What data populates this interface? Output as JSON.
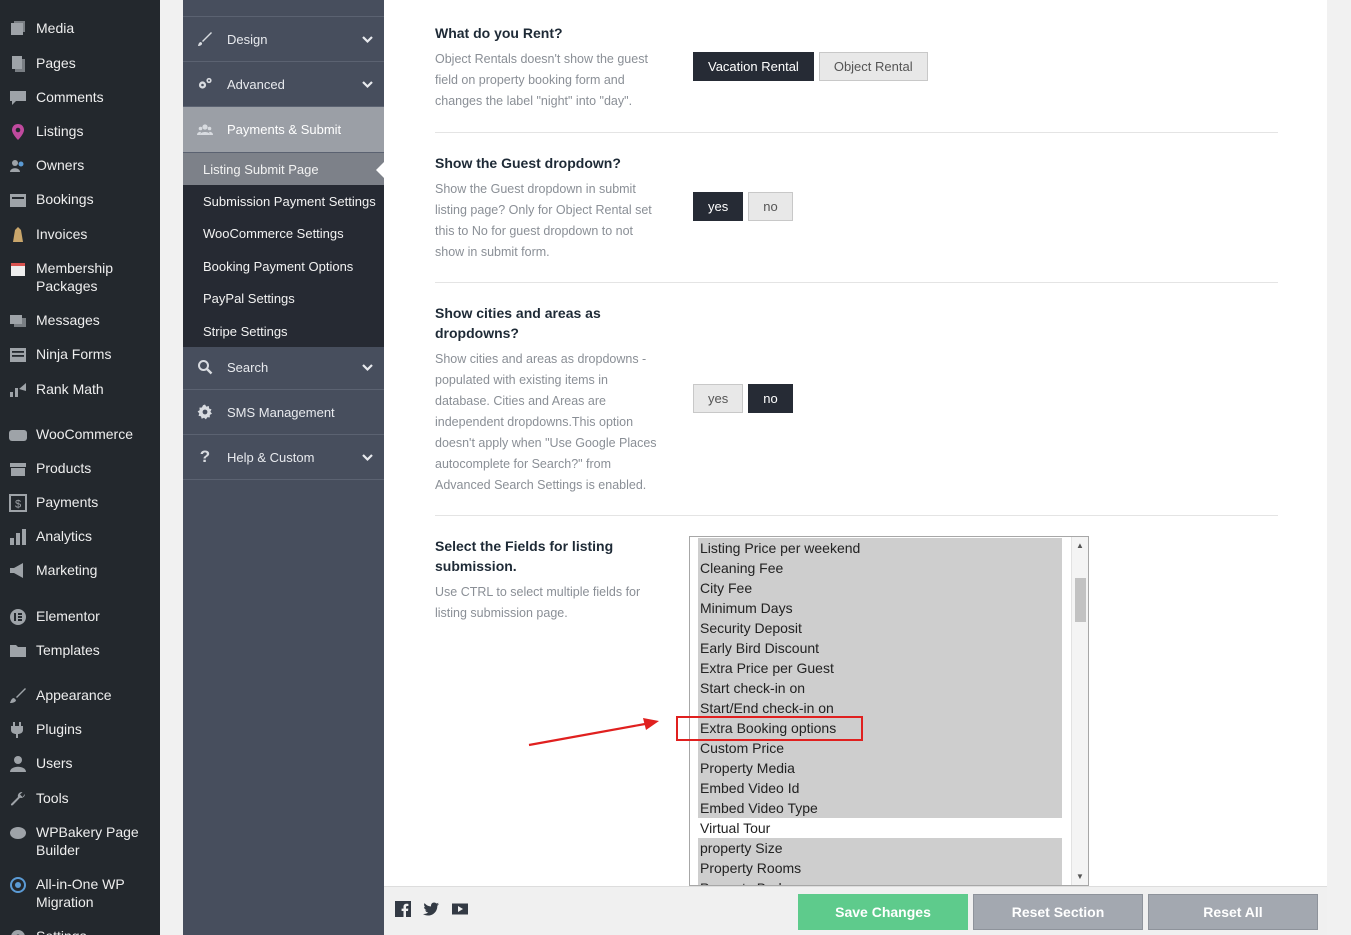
{
  "wp_menu": [
    {
      "label": "Media",
      "icon": "media-icon"
    },
    {
      "label": "Pages",
      "icon": "pages-icon"
    },
    {
      "label": "Comments",
      "icon": "comments-icon"
    },
    {
      "label": "Listings",
      "icon": "pin-icon"
    },
    {
      "label": "Owners",
      "icon": "owners-icon"
    },
    {
      "label": "Bookings",
      "icon": "bookings-icon"
    },
    {
      "label": "Invoices",
      "icon": "invoices-icon"
    },
    {
      "label": "Membership Packages",
      "icon": "calendar-icon"
    },
    {
      "label": "Messages",
      "icon": "messages-icon"
    },
    {
      "label": "Ninja Forms",
      "icon": "forms-icon"
    },
    {
      "label": "Rank Math",
      "icon": "chart-icon"
    },
    {
      "label": "WooCommerce",
      "icon": "woo-icon"
    },
    {
      "label": "Products",
      "icon": "products-icon"
    },
    {
      "label": "Payments",
      "icon": "dollar-icon"
    },
    {
      "label": "Analytics",
      "icon": "analytics-icon"
    },
    {
      "label": "Marketing",
      "icon": "megaphone-icon"
    },
    {
      "label": "Elementor",
      "icon": "elementor-icon"
    },
    {
      "label": "Templates",
      "icon": "folder-icon"
    },
    {
      "label": "Appearance",
      "icon": "brush-icon"
    },
    {
      "label": "Plugins",
      "icon": "plugin-icon"
    },
    {
      "label": "Users",
      "icon": "user-icon"
    },
    {
      "label": "Tools",
      "icon": "wrench-icon"
    },
    {
      "label": "WPBakery Page Builder",
      "icon": "bakery-icon"
    },
    {
      "label": "All-in-One WP Migration",
      "icon": "migration-icon"
    },
    {
      "label": "Settings",
      "icon": "settings-icon"
    }
  ],
  "options_nav": {
    "sections": [
      {
        "label": "Design",
        "icon": "brush-icon",
        "chevron": true
      },
      {
        "label": "Advanced",
        "icon": "cogs-icon",
        "chevron": true
      },
      {
        "label": "Payments & Submit",
        "icon": "group-icon",
        "chevron": false
      },
      {
        "label": "Search",
        "icon": "search-icon",
        "chevron": true
      },
      {
        "label": "SMS Management",
        "icon": "gear-icon",
        "chevron": false
      },
      {
        "label": "Help & Custom",
        "icon": "question-icon",
        "chevron": true
      }
    ],
    "sub_items": [
      "Listing Submit Page",
      "Submission Payment Settings",
      "WooCommerce Settings",
      "Booking Payment Options",
      "PayPal Settings",
      "Stripe Settings"
    ]
  },
  "options": {
    "rent": {
      "title": "What do you Rent?",
      "desc": "Object Rentals doesn't show the guest field on property booking form and changes the label \"night\" into \"day\".",
      "buttons": [
        "Vacation Rental",
        "Object Rental"
      ],
      "selected": "Vacation Rental"
    },
    "guest": {
      "title": "Show the Guest dropdown?",
      "desc": "Show the Guest dropdown in submit listing page? Only for Object Rental set this to No for guest dropdown to not show in submit form.",
      "buttons": [
        "yes",
        "no"
      ],
      "selected": "yes"
    },
    "cities": {
      "title": "Show cities and areas as dropdowns?",
      "desc": "Show cities and areas as dropdowns - populated with existing items in database. Cities and Areas are independent dropdowns.This option doesn't apply when \"Use Google Places autocomplete for Search?\" from Advanced Search Settings is enabled.",
      "buttons": [
        "yes",
        "no"
      ],
      "selected": "no"
    },
    "fields": {
      "title": "Select the Fields for listing submission.",
      "desc": "Use CTRL to select multiple fields for listing submission page.",
      "items": [
        {
          "label": "Listing Price per weekend",
          "selected": true
        },
        {
          "label": "Cleaning Fee",
          "selected": true
        },
        {
          "label": "City Fee",
          "selected": true
        },
        {
          "label": "Minimum Days",
          "selected": true
        },
        {
          "label": "Security Deposit",
          "selected": true
        },
        {
          "label": "Early Bird Discount",
          "selected": true
        },
        {
          "label": "Extra Price per Guest",
          "selected": true
        },
        {
          "label": "Start check-in on",
          "selected": true
        },
        {
          "label": "Start/End check-in on",
          "selected": true
        },
        {
          "label": "Extra Booking options",
          "selected": true
        },
        {
          "label": "Custom Price",
          "selected": true
        },
        {
          "label": "Property Media",
          "selected": true
        },
        {
          "label": "Embed Video Id",
          "selected": true
        },
        {
          "label": "Embed Video Type",
          "selected": true
        },
        {
          "label": "Virtual Tour",
          "selected": false
        },
        {
          "label": "property Size",
          "selected": true
        },
        {
          "label": "Property Rooms",
          "selected": true
        },
        {
          "label": "Property Bedrooms",
          "selected": true
        }
      ]
    }
  },
  "footer": {
    "social_icons": [
      "facebook-icon",
      "twitter-icon",
      "youtube-icon"
    ],
    "save": "Save Changes",
    "reset_section": "Reset Section",
    "reset_all": "Reset All"
  },
  "colors": {
    "save": "#5ecb8c",
    "reset": "#a3a8b0",
    "active_toggle": "#262b35",
    "annotation": "#e0201f"
  }
}
